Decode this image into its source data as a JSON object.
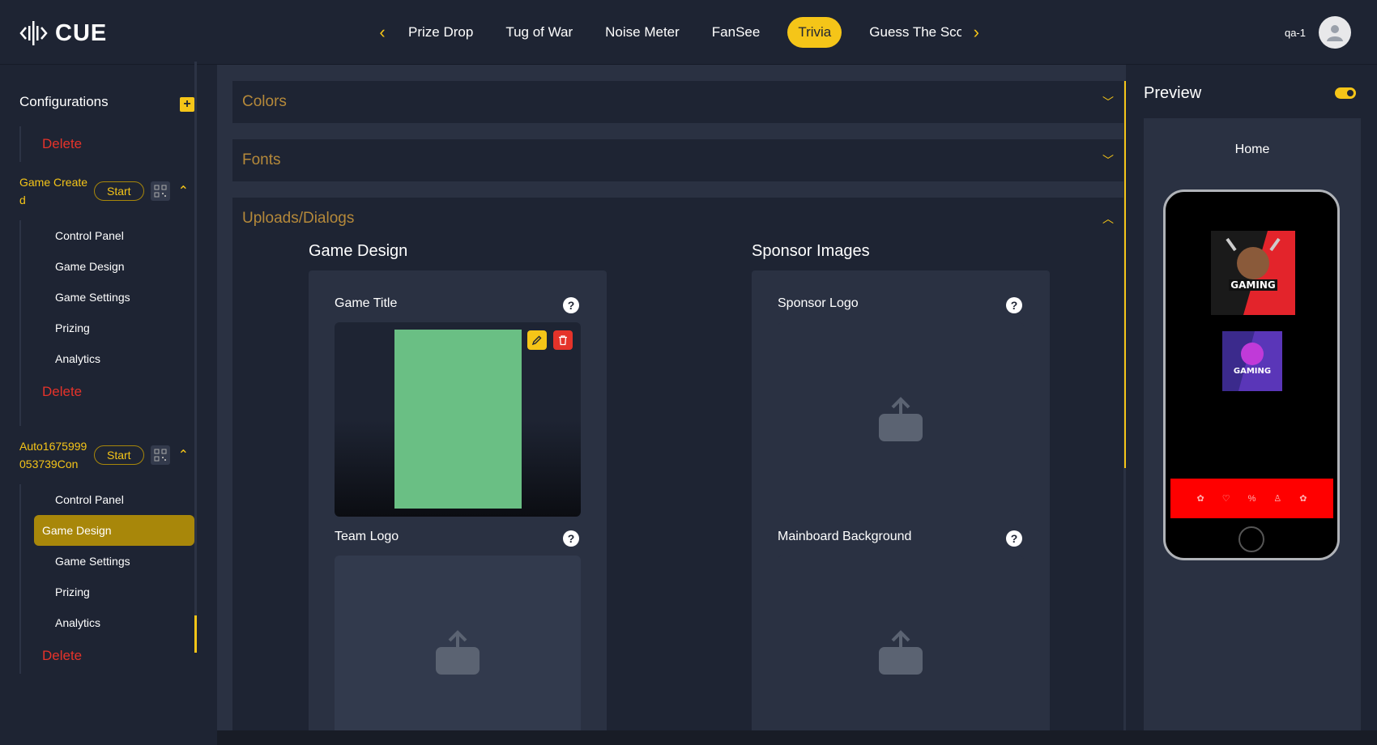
{
  "app": {
    "logo_text": "CUE",
    "user_name": "qa-1"
  },
  "tabs": [
    {
      "label": "Prize Drop",
      "active": false
    },
    {
      "label": "Tug of War",
      "active": false
    },
    {
      "label": "Noise Meter",
      "active": false
    },
    {
      "label": "FanSee",
      "active": false
    },
    {
      "label": "Trivia",
      "active": true
    },
    {
      "label": "Guess The Sco",
      "active": false
    }
  ],
  "sidebar": {
    "title": "Configurations",
    "delete_label": "Delete",
    "groups": [
      {
        "name": "Game Created",
        "start_label": "Start",
        "items": [
          "Control Panel",
          "Game Design",
          "Game Settings",
          "Prizing",
          "Analytics"
        ],
        "active_item": null
      },
      {
        "name": "Auto1675999053739Con",
        "start_label": "Start",
        "items": [
          "Control Panel",
          "Game Design",
          "Game Settings",
          "Prizing",
          "Analytics"
        ],
        "active_item": "Game Design"
      }
    ]
  },
  "main": {
    "accordions": [
      "Colors",
      "Fonts",
      "Uploads/Dialogs"
    ],
    "game_design": {
      "title": "Game Design",
      "fields": [
        "Game Title",
        "Team Logo"
      ]
    },
    "sponsor_images": {
      "title": "Sponsor Images",
      "fields": [
        "Sponsor Logo",
        "Mainboard Background"
      ]
    },
    "help_glyph": "?"
  },
  "preview": {
    "title": "Preview",
    "screen_label": "Home",
    "logo1_text": "GAMING",
    "logo2_text": "GAMING",
    "navbar_color": "#ff0000"
  },
  "colors": {
    "accent": "#f5c518",
    "danger": "#e5332a",
    "bg": "#1e2433",
    "panel": "#2a3142"
  }
}
